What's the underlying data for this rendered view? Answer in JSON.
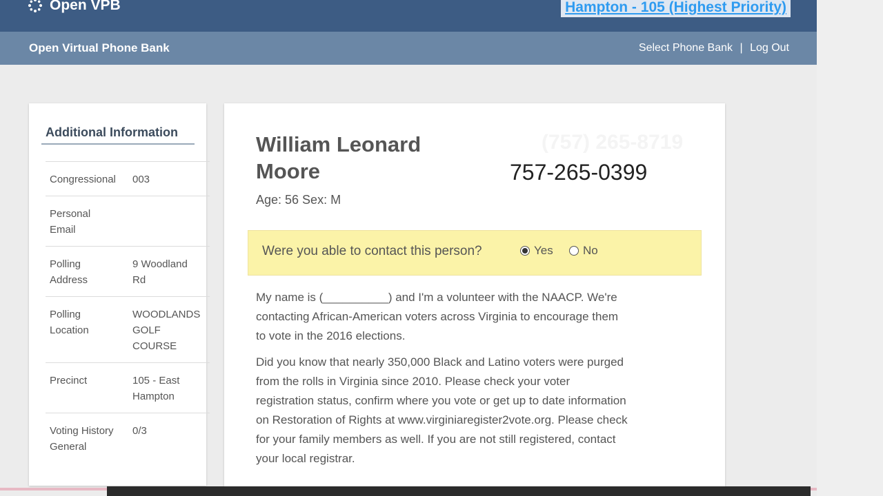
{
  "header": {
    "brand": "Open VPB",
    "campaign": "Hampton - 105 (Highest Priority)"
  },
  "subbar": {
    "title": "Open Virtual Phone Bank",
    "nav": [
      "Select Phone Bank",
      "Log Out"
    ],
    "separator": "|"
  },
  "sidebar": {
    "heading": "Additional Information",
    "rows": [
      {
        "key": "Congressional",
        "value": "003"
      },
      {
        "key": "Personal Email",
        "value": ""
      },
      {
        "key": "Polling Address",
        "value": "9 Woodland Rd"
      },
      {
        "key": "Polling Location",
        "value": "WOODLANDS GOLF COURSE"
      },
      {
        "key": "Precinct",
        "value": "105 - East Hampton"
      },
      {
        "key": "Voting History General",
        "value": "0/3"
      }
    ]
  },
  "person": {
    "name": "William Leonard Moore",
    "demographics": "Age: 56 Sex: M",
    "phone_faded": "(757) 265-8719",
    "phone": "757-265-0399"
  },
  "contact": {
    "question": "Were you able to contact this person?",
    "options": [
      {
        "label": "Yes",
        "selected": true
      },
      {
        "label": "No",
        "selected": false
      }
    ]
  },
  "script": {
    "p1": "My name is (__________) and I'm a volunteer with the NAACP. We're contacting African-American voters across Virginia to encourage them to vote in the 2016 elections.",
    "p2": "Did you know that nearly 350,000 Black and Latino voters were purged from the rolls in Virginia since 2010. Please check your voter registration status, confirm where you vote or get up to date information on Restoration of Rights at www.virginiaregister2vote.org. Please check for your family members as well. If you are not still registered, contact your local registrar."
  },
  "colors": {
    "topbar": "#3d5c84",
    "subbar": "#6b87a6",
    "highlight": "#fbf3a8",
    "link": "#2f9bf0"
  }
}
